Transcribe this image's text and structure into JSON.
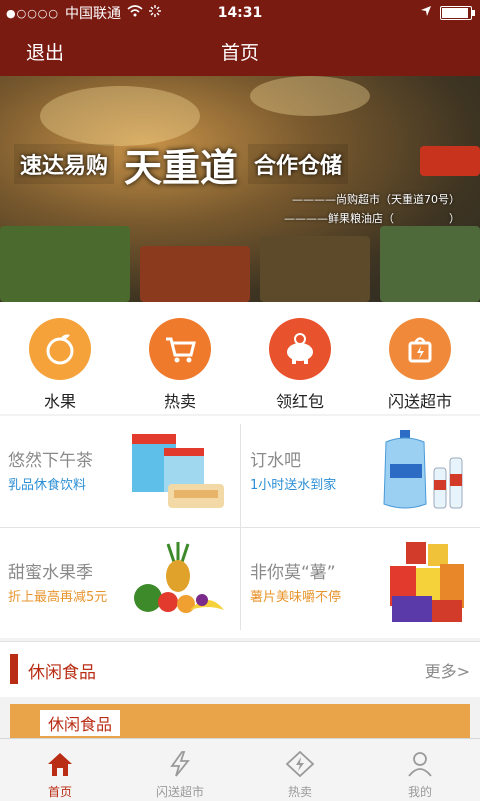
{
  "status_bar": {
    "carrier": "中国联通",
    "time": "14:31",
    "signal": "●○○○○"
  },
  "navbar": {
    "back_label": "退出",
    "title": "首页"
  },
  "banner": {
    "brand": "速达易购",
    "headline": "天重道",
    "tag": "合作仓储",
    "line1": "————尚购超市（天重道70号）",
    "line2": "————鲜果粮油店（　　　　　）"
  },
  "categories": [
    {
      "label": "水果",
      "icon": "orange-fruit-icon",
      "color": "#f5a23a"
    },
    {
      "label": "热卖",
      "icon": "shopping-cart-icon",
      "color": "#f07a2c"
    },
    {
      "label": "领红包",
      "icon": "piggy-bank-icon",
      "color": "#e8532d"
    },
    {
      "label": "闪送超市",
      "icon": "shopping-bag-icon",
      "color": "#f08a3a"
    }
  ],
  "promos": [
    {
      "title": "悠然下午茶",
      "subtitle": "乳品休食饮料",
      "subtitle_color": "#2c8fd6"
    },
    {
      "title": "订水吧",
      "subtitle": "1小时送水到家",
      "subtitle_color": "#2c8fd6"
    },
    {
      "title": "甜蜜水果季",
      "subtitle": "折上最高再减5元",
      "subtitle_color": "#e8952d"
    },
    {
      "title": "非你莫“薯”",
      "subtitle": "薯片美味嚼不停",
      "subtitle_color": "#e8952d"
    }
  ],
  "section": {
    "title": "休闲食品",
    "more": "更多>"
  },
  "snack_banner": {
    "tag": "休闲食品"
  },
  "tabs": [
    {
      "label": "首页",
      "icon": "home-icon",
      "active": true
    },
    {
      "label": "闪送超市",
      "icon": "lightning-icon",
      "active": false
    },
    {
      "label": "热卖",
      "icon": "flash-tag-icon",
      "active": false
    },
    {
      "label": "我的",
      "icon": "user-icon",
      "active": false
    }
  ],
  "colors": {
    "brand": "#7a1b12",
    "accent": "#b92d14"
  }
}
